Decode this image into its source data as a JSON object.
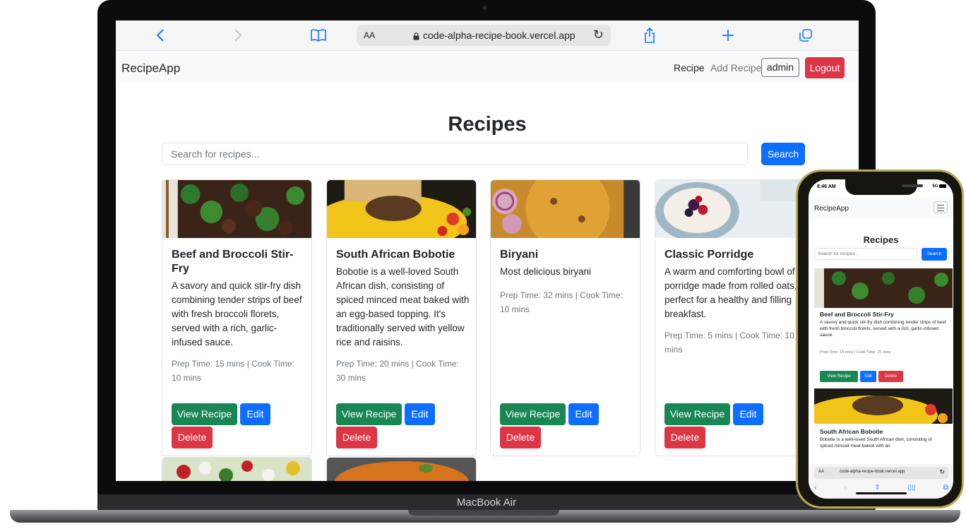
{
  "laptop": {
    "label": "MacBook Air"
  },
  "safari": {
    "text_size": "AA",
    "url": "code-alpha-recipe-book.vercel.app"
  },
  "navbar": {
    "brand": "RecipeApp",
    "links": [
      "Recipe",
      "Add Recipe"
    ],
    "user": "admin",
    "logout": "Logout"
  },
  "main": {
    "title": "Recipes",
    "search_placeholder": "Search for recipes...",
    "search_button": "Search"
  },
  "buttons": {
    "view": "View Recipe",
    "edit": "Edit",
    "delete": "Delete"
  },
  "recipes": [
    {
      "title": "Beef and Broccoli Stir-Fry",
      "description": "A savory and quick stir-fry dish combining tender strips of beef with fresh broccoli florets, served with a rich, garlic-infused sauce.",
      "times": "Prep Time: 15 mins | Cook Time: 10 mins"
    },
    {
      "title": "South African Bobotie",
      "description": "Bobotie is a well-loved South African dish, consisting of spiced minced meat baked with an egg-based topping. It's traditionally served with yellow rice and raisins.",
      "times": "Prep Time: 20 mins | Cook Time: 30 mins"
    },
    {
      "title": "Biryani",
      "description": "Most delicious biryani",
      "times": "Prep Time: 32 mins | Cook Time: 10 mins"
    },
    {
      "title": "Classic Porridge",
      "description": "A warm and comforting bowl of porridge made from rolled oats, perfect for a healthy and filling breakfast.",
      "times": "Prep Time: 5 mins | Cook Time: 10 mins"
    }
  ],
  "phone": {
    "time": "8:46 AM",
    "signal": "5G",
    "brand": "RecipeApp",
    "title": "Recipes",
    "search_placeholder": "Search for recipes...",
    "search_button": "Search",
    "card1_title": "Beef and Broccoli Stir-Fry",
    "card1_text": "A savory and quick stir-fry dish combining tender strips of beef with fresh broccoli florets, served with a rich, garlic-infused sauce.",
    "card1_times": "Prep Time: 15 mins | Cook Time: 10 mins",
    "card2_title": "South African Bobotie",
    "card2_text": "Bobotie is a well-loved South African dish, consisting of spiced minced meat baked with an",
    "text_size": "AA",
    "url": "code-alpha-recipe-book.vercel.app"
  },
  "colors": {
    "primary": "#0d6efd",
    "success": "#198754",
    "danger": "#dc3545",
    "phone_frame": "#b9ab55"
  }
}
